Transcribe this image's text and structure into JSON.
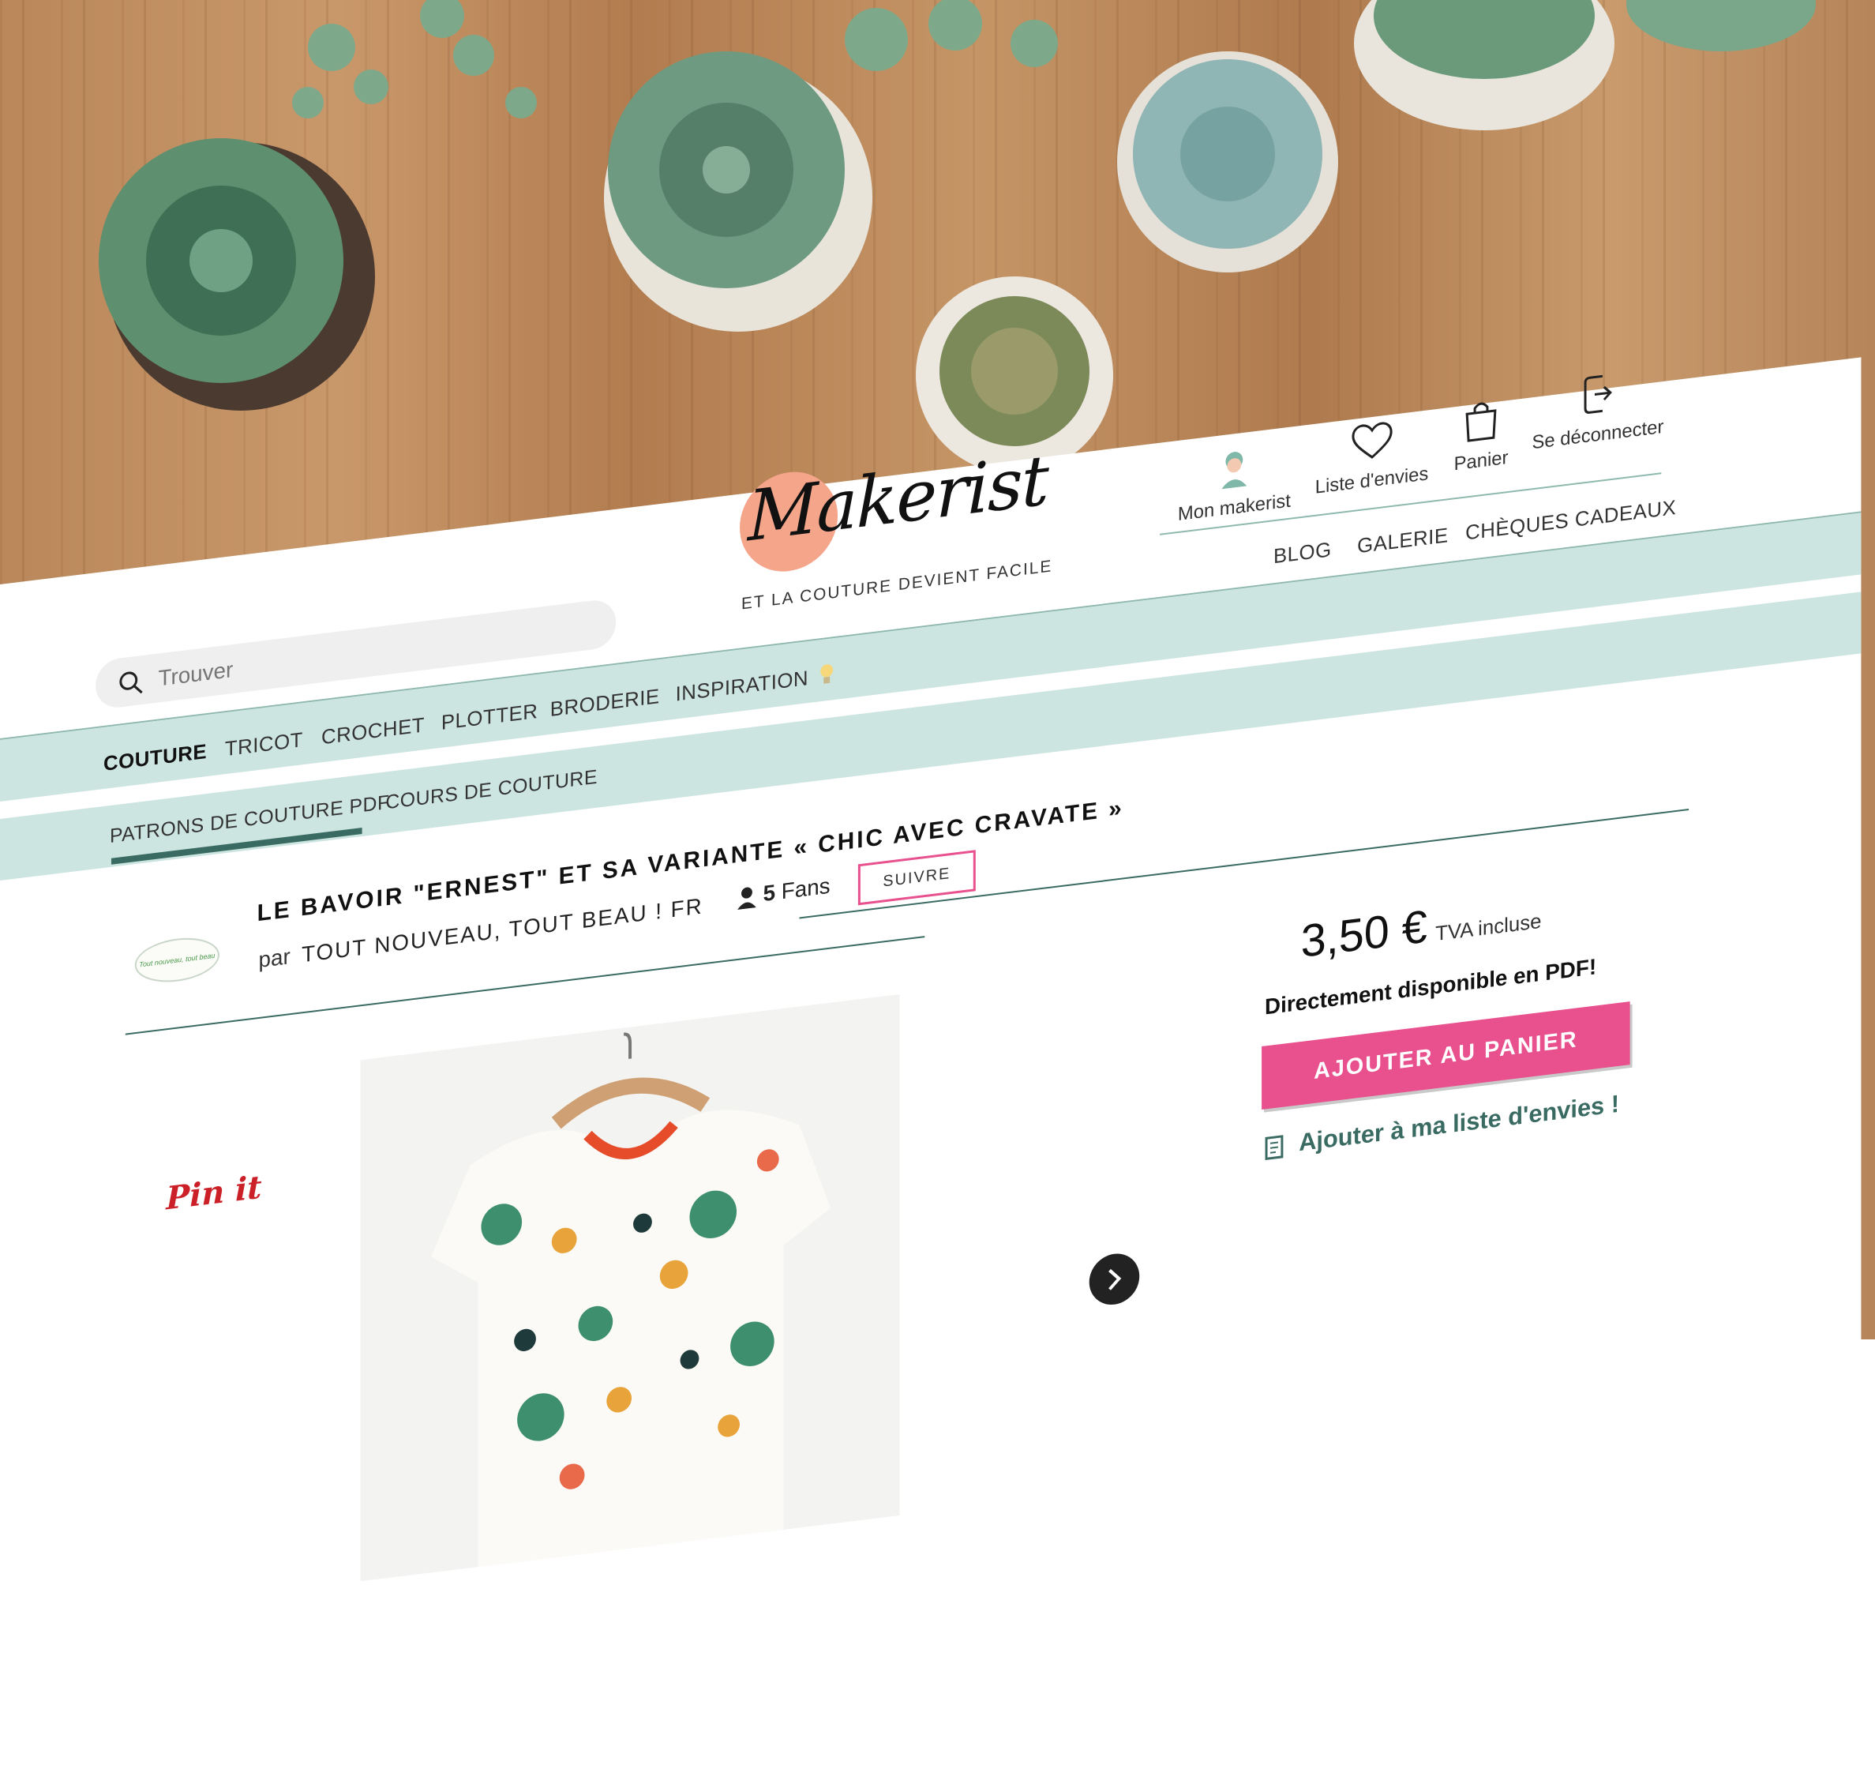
{
  "brand": {
    "logo_text": "Makerist",
    "tagline": "ET LA COUTURE DEVIENT FACILE",
    "accent": "#f4a58a"
  },
  "search": {
    "placeholder": "Trouver"
  },
  "header_actions": [
    {
      "label": "Mon makerist",
      "icon": "avatar-icon"
    },
    {
      "label": "Liste d'envies",
      "icon": "heart-icon"
    },
    {
      "label": "Panier",
      "icon": "bag-icon"
    },
    {
      "label": "Se déconnecter",
      "icon": "logout-icon"
    }
  ],
  "secondary_nav": [
    "BLOG",
    "GALERIE",
    "CHÈQUES CADEAUX"
  ],
  "categories": [
    "COUTURE",
    "TRICOT",
    "CROCHET",
    "PLOTTER",
    "BRODERIE",
    "INSPIRATION"
  ],
  "active_category": "COUTURE",
  "sub_nav": [
    "PATRONS DE COUTURE PDF",
    "COURS DE COUTURE"
  ],
  "active_sub_nav": "PATRONS DE COUTURE PDF",
  "product": {
    "title": "LE BAVOIR \"ERNEST\" ET SA VARIANTE « CHIC AVEC CRAVATE »",
    "by_prefix": "par",
    "designer": "TOUT NOUVEAU, TOUT BEAU ! FR",
    "designer_logo_text": "Tout nouveau, tout beau",
    "fans_count": "5",
    "fans_label": "Fans",
    "follow_label": "SUIVRE",
    "price": "3,50 €",
    "price_note": "TVA incluse",
    "availability": "Directement disponible en PDF!",
    "add_to_cart_label": "AJOUTER AU PANIER",
    "wishlist_label": "Ajouter à ma liste d'envies !",
    "pinit_label": "Pin it"
  },
  "colors": {
    "mint": "#cde5e0",
    "teal": "#3a6b62",
    "pink": "#e8508e",
    "pin_red": "#cb2027"
  }
}
